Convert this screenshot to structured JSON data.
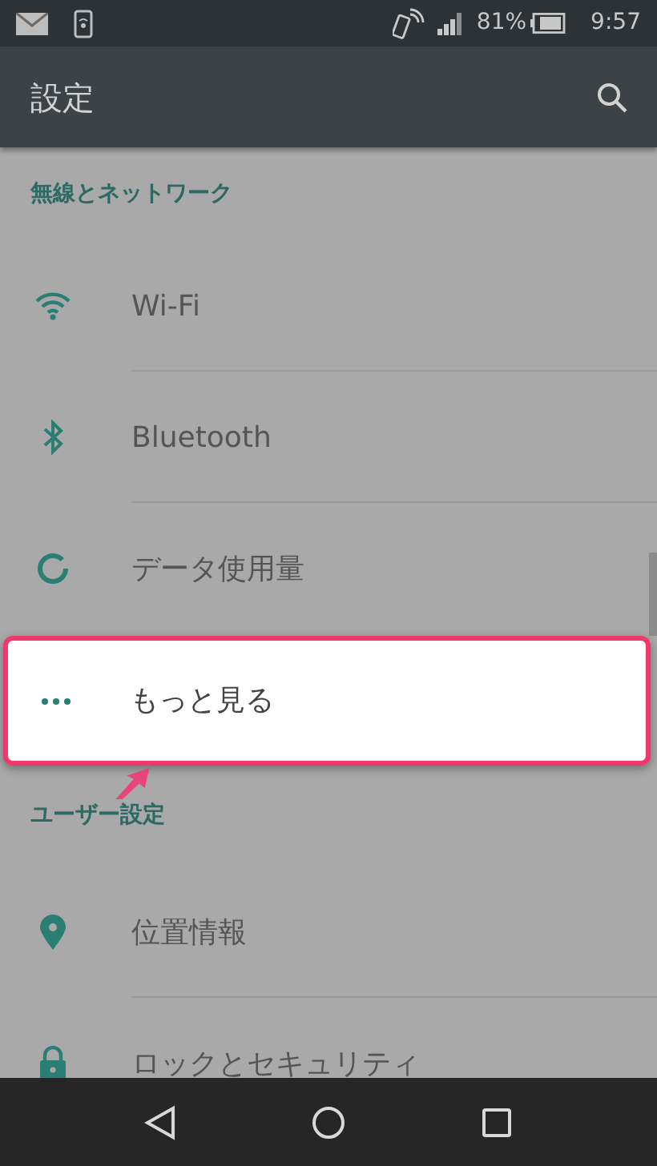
{
  "status_bar": {
    "battery": "81%",
    "time": "9:57"
  },
  "toolbar": {
    "title": "設定"
  },
  "sections": [
    {
      "header": "無線とネットワーク",
      "items": [
        {
          "label": "Wi-Fi",
          "highlighted": false
        },
        {
          "label": "Bluetooth",
          "highlighted": false
        },
        {
          "label": "データ使用量",
          "highlighted": false
        },
        {
          "label": "もっと見る",
          "highlighted": true
        }
      ]
    },
    {
      "header": "ユーザー設定",
      "items": [
        {
          "label": "位置情報",
          "highlighted": false
        },
        {
          "label": "ロックとセキュリティ",
          "highlighted": false
        }
      ]
    }
  ]
}
